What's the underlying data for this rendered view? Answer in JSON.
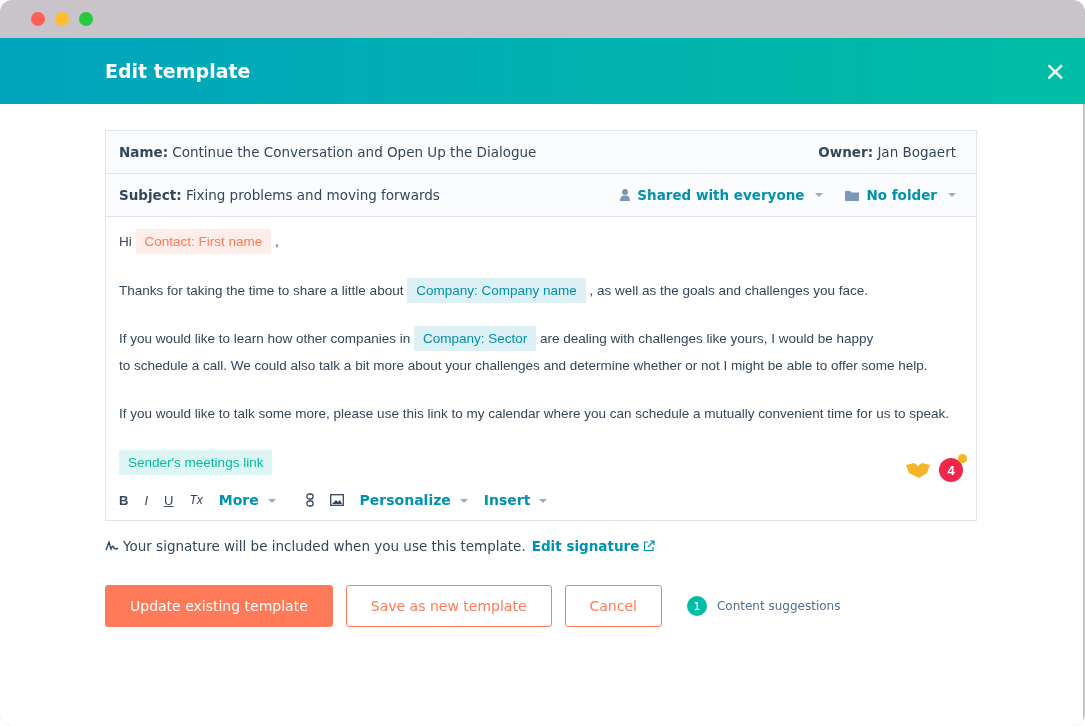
{
  "window": {
    "title": "Edit template",
    "close": "×"
  },
  "template": {
    "name_label": "Name:",
    "name": "Continue the Conversation and Open Up the Dialogue",
    "owner_label": "Owner:",
    "owner": "Jan Bogaert",
    "subject_label": "Subject:",
    "subject": "Fixing problems and moving forwards",
    "sharing": "Shared with everyone",
    "folder": "No folder"
  },
  "body": [
    [
      {
        "kind": "text",
        "text": "Hi"
      },
      {
        "kind": "token",
        "text": "Contact: First name",
        "color": "#ff7a59"
      },
      {
        "kind": "text",
        "text": ","
      }
    ],
    [
      {
        "kind": "text",
        "text": "Thanks for taking the time to share a little about"
      },
      {
        "kind": "token",
        "text": "Company: Company name",
        "color": "#0091ae"
      },
      {
        "kind": "text",
        "text": ", as well as the goals and challenges you face."
      }
    ],
    [
      {
        "kind": "text",
        "text": "If you would like to learn how other companies in"
      },
      {
        "kind": "token",
        "text": "Company: Sector",
        "color": "#0091ae"
      },
      {
        "kind": "text",
        "text": "are dealing with challenges like yours, I would be happy"
      },
      {
        "kind": "text",
        "text": "to schedule a call. We could also talk a bit more about your challenges and determine whether or not I might be able to offer"
      },
      {
        "kind": "text",
        "text": "some help."
      }
    ],
    [
      {
        "kind": "text",
        "text": "If you would like to talk some more, please use this link to my calendar where you can schedule a mutually convenient time for"
      },
      {
        "kind": "text",
        "text": "us to speak."
      }
    ],
    [
      {
        "kind": "token",
        "text": "Sender's meetings link",
        "color": "#00bda5"
      }
    ]
  ],
  "badge_count": "4",
  "toolbar": [
    {
      "kind": "format",
      "text": "B"
    },
    {
      "kind": "format",
      "text": "I"
    },
    {
      "kind": "format",
      "text": "U"
    },
    {
      "kind": "format",
      "text": "Tx"
    },
    {
      "kind": "menu",
      "text": "More"
    },
    {
      "kind": "link"
    },
    {
      "kind": "image"
    },
    {
      "kind": "menu",
      "text": "Personalize"
    },
    {
      "kind": "menu",
      "text": "Insert"
    }
  ],
  "signature": {
    "text": "Your signature will be included when you use this template.",
    "link": "Edit signature"
  },
  "buttons": [
    {
      "kind": "primary",
      "label": "Update existing template"
    },
    {
      "kind": "secondary",
      "label": "Save as new template"
    },
    {
      "kind": "secondary",
      "label": "Cancel"
    }
  ],
  "suggestions": {
    "count": "1",
    "label": "Content suggestions"
  }
}
